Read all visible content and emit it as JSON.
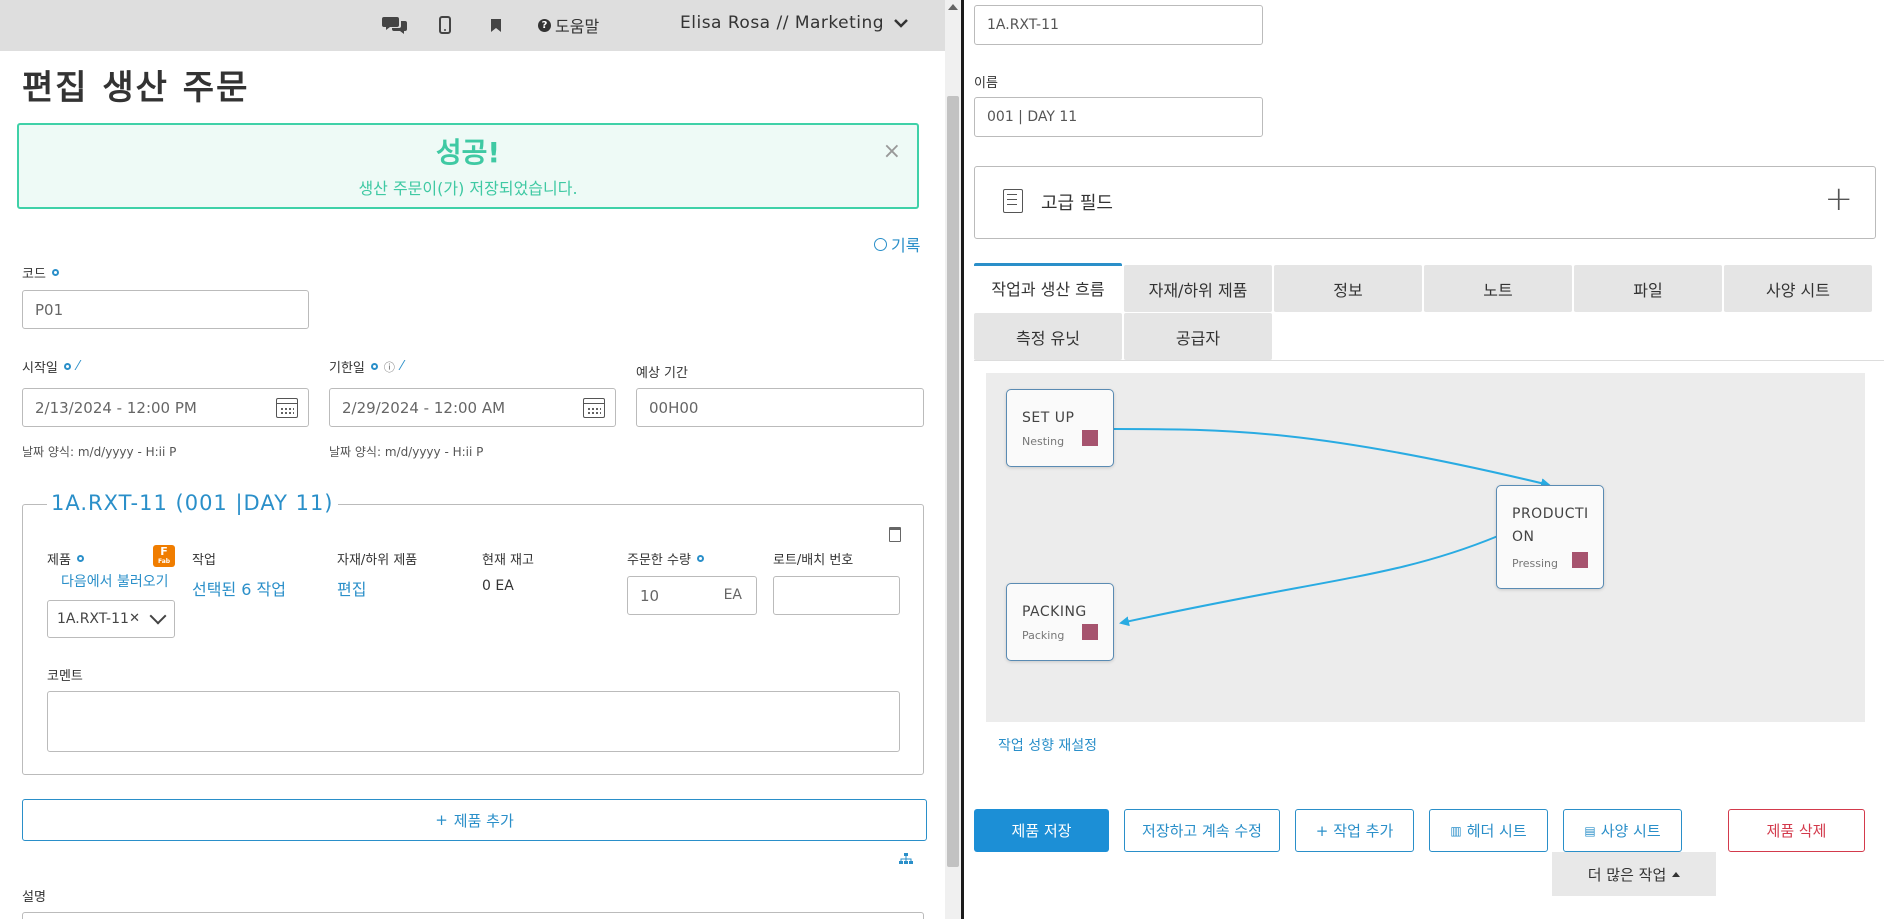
{
  "topbar": {
    "help_label": "도움말",
    "user_label": "Elisa Rosa // Marketing"
  },
  "page": {
    "title": "편집 생산 주문",
    "history_label": "기록"
  },
  "alert": {
    "title": "성공!",
    "message": "생산 주문이(가) 저장되었습니다.",
    "close": "×"
  },
  "form": {
    "code_label": "코드",
    "code_value": "P01",
    "start_label": "시작일",
    "start_value": "2/13/2024 - 12:00 PM",
    "start_hint": "날짜 양식: m/d/yyyy - H:ii P",
    "due_label": "기한일",
    "due_value": "2/29/2024 - 12:00 AM",
    "due_hint": "날짜 양식: m/d/yyyy - H:ii P",
    "duration_label": "예상 기간",
    "duration_value": "00H00"
  },
  "product_block": {
    "legend": "1A.RXT-11 (001 |DAY 11)",
    "product_header": "제품",
    "import_link": "다음에서 불러오기",
    "select_value": "1A.RXT-11",
    "task_header": "작업",
    "task_link": "선택된 6 작업",
    "material_header": "자재/하위 제품",
    "material_link": "편집",
    "stock_header": "현재 재고",
    "stock_value": "0 EA",
    "qty_header": "주문한 수량",
    "qty_value": "10",
    "qty_unit": "EA",
    "lot_header": "로트/배치 번호",
    "comment_label": "코멘트"
  },
  "add_product_label": "제품 추가",
  "description_label": "설명",
  "right": {
    "code_value": "1A.RXT-11",
    "name_label": "이름",
    "name_value": "001 | DAY 11",
    "advanced_label": "고급 필드",
    "tabs": [
      {
        "label": "작업과 생산 흐름"
      },
      {
        "label": "자재/하위 제품"
      },
      {
        "label": "정보"
      },
      {
        "label": "노트"
      },
      {
        "label": "파일"
      },
      {
        "label": "사양 시트"
      },
      {
        "label": "측정 유닛"
      },
      {
        "label": "공급자"
      }
    ],
    "nodes": [
      {
        "name": "SET UP",
        "sub": "Nesting"
      },
      {
        "name": "PRODUCTI\nON",
        "sub": "Pressing"
      },
      {
        "name": "PACKING",
        "sub": "Packing"
      }
    ],
    "reset_link": "작업 성향 재설정",
    "buttons": {
      "save": "제품 저장",
      "save_continue": "저장하고 계속 수정",
      "add_task": "작업 추가",
      "header_sheet": "헤더 시트",
      "spec_sheet": "사양 시트",
      "delete": "제품 삭제",
      "more": "더 많은 작업"
    }
  },
  "colors": {
    "accent": "#2a8fc9",
    "success": "#3fc9a3",
    "danger": "#d33a4c",
    "node_square": "#a6536e",
    "flow_arrow": "#29abe2"
  }
}
